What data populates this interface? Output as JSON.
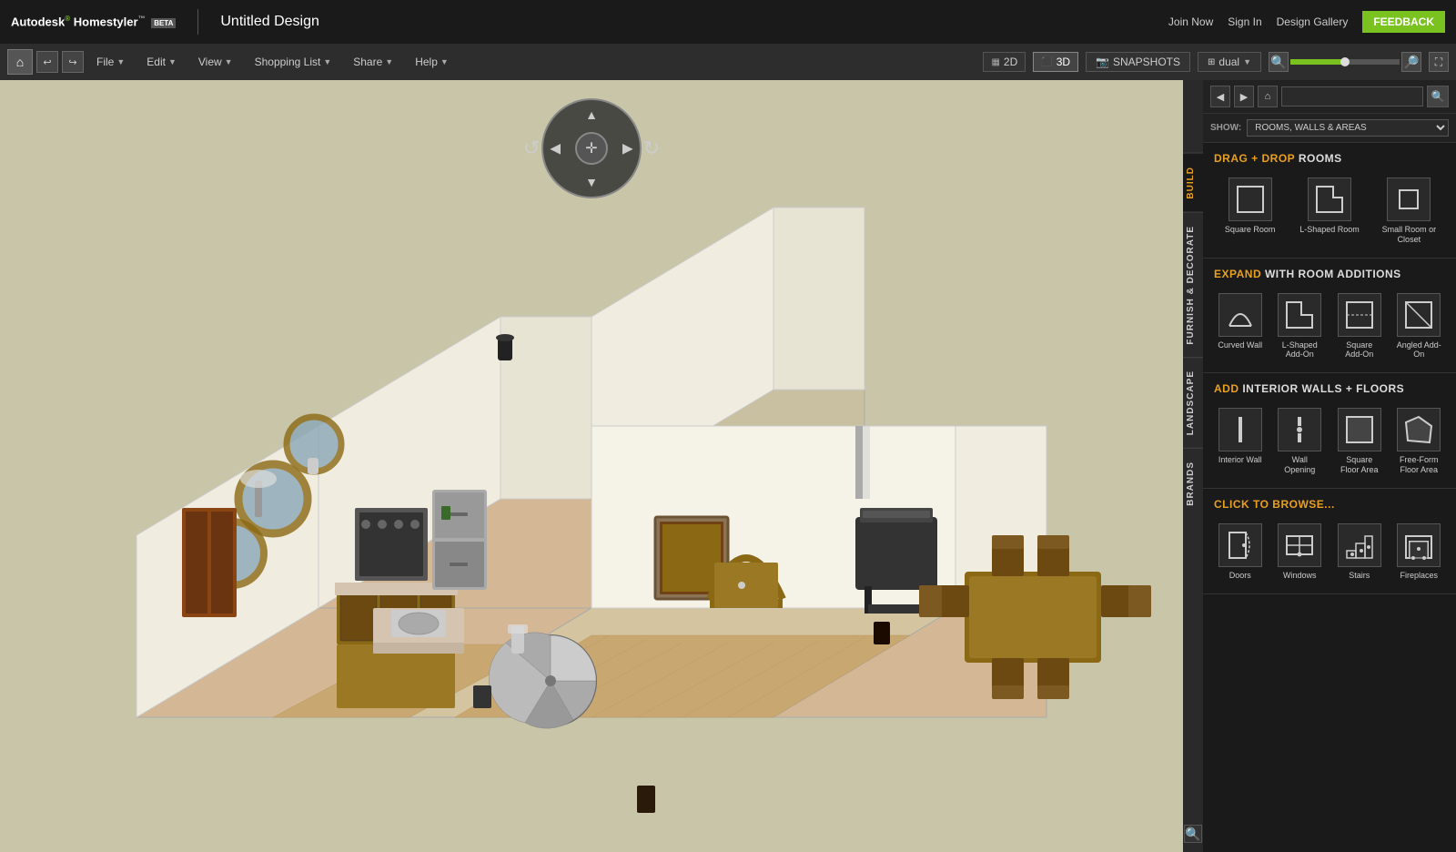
{
  "topbar": {
    "logo": "Autodesk® Homestyler™",
    "beta": "BETA",
    "title": "Untitled Design",
    "links": [
      "Join Now",
      "Sign In",
      "Design Gallery"
    ],
    "feedback": "FEEDBACK"
  },
  "menubar": {
    "menus": [
      "File",
      "Edit",
      "View",
      "Shopping List",
      "Share",
      "Help"
    ],
    "view2d": "2D",
    "view3d": "3D",
    "snapshots": "SNAPSHOTS",
    "dual": "dual"
  },
  "panel": {
    "build_label": "BUILD",
    "furnish_label": "FURNISH & DECORATE",
    "landscape_label": "LANDSCAPE",
    "brands_label": "BRANDS",
    "show_label": "SHOW:",
    "show_value": "ROOMS, WALLS & AREAS",
    "sections": {
      "drag_drop": {
        "title_highlight": "DRAG + DROP",
        "title_normal": "ROOMS",
        "items": [
          {
            "label": "Square Room",
            "icon": "square-room"
          },
          {
            "label": "L-Shaped Room",
            "icon": "l-shaped-room"
          },
          {
            "label": "Small Room or Closet",
            "icon": "small-room"
          }
        ]
      },
      "expand": {
        "title_highlight": "EXPAND",
        "title_normal": "WITH ROOM ADDITIONS",
        "items": [
          {
            "label": "Curved Wall",
            "icon": "curved-wall"
          },
          {
            "label": "L-Shaped Add-On",
            "icon": "l-shaped-addon"
          },
          {
            "label": "Square Add-On",
            "icon": "square-addon"
          },
          {
            "label": "Angled Add-On",
            "icon": "angled-addon"
          }
        ]
      },
      "interior": {
        "title_add": "ADD",
        "title_normal": "INTERIOR WALLS + FLOORS",
        "items": [
          {
            "label": "Interior Wall",
            "icon": "interior-wall"
          },
          {
            "label": "Wall Opening",
            "icon": "wall-opening"
          },
          {
            "label": "Square Floor Area",
            "icon": "square-floor"
          },
          {
            "label": "Free-Form Floor Area",
            "icon": "freeform-floor"
          }
        ]
      },
      "browse": {
        "title": "CLICK TO BROWSE...",
        "items": [
          {
            "label": "Doors",
            "icon": "doors"
          },
          {
            "label": "Windows",
            "icon": "windows"
          },
          {
            "label": "Stairs",
            "icon": "stairs"
          },
          {
            "label": "Fireplaces",
            "icon": "fireplaces"
          }
        ]
      }
    }
  },
  "nav": {
    "rotate_left": "↺",
    "rotate_right": "↻",
    "up": "▲",
    "down": "▼",
    "left": "◀",
    "right": "▶",
    "center": "✛"
  }
}
